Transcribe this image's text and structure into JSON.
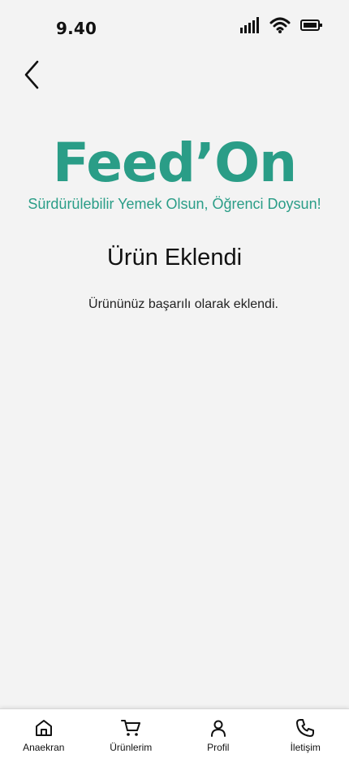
{
  "status_bar": {
    "time": "9.40",
    "icons": [
      "signal-icon",
      "wifi-icon",
      "battery-icon"
    ]
  },
  "header": {
    "back_icon": "chevron-left-icon"
  },
  "brand": {
    "name": "Feed’On",
    "tagline": "Sürdürülebilir Yemek Olsun, Öğrenci Doysun!",
    "color": "#2a9d87"
  },
  "main": {
    "title": "Ürün Eklendi",
    "message": "Ürününüz başarılı olarak eklendi."
  },
  "bottom_nav": {
    "items": [
      {
        "label": "Anaekran",
        "icon": "home-icon"
      },
      {
        "label": "Ürünlerim",
        "icon": "cart-icon"
      },
      {
        "label": "Profil",
        "icon": "user-icon"
      },
      {
        "label": "İletişim",
        "icon": "phone-icon"
      }
    ]
  }
}
